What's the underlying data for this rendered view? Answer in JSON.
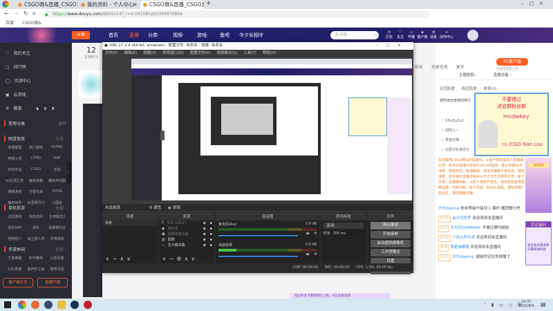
{
  "browser": {
    "tabs": [
      {
        "label": "CSGO微&直播_CSGO直播_"
      },
      {
        "label": "我的资料 - 个人中心 - 斗鱼"
      },
      {
        "label": "CSGO微&直播_CSGO直播_"
      }
    ],
    "new_tab": "+",
    "url_scheme": "https://",
    "url_host": "www.douyu.com",
    "url_path": "/6959154?_r=0.0415852023939768­94",
    "bookmarks": [
      "百度",
      "CSGO微&"
    ]
  },
  "douyu": {
    "nav": [
      "首页",
      "直播",
      "分类·",
      "视频·",
      "游戏·",
      "鱼吧",
      "今夕长相守"
    ],
    "search_placeholder": "无法搜",
    "header_icons": [
      "历史",
      "关注",
      "开播",
      "客户端",
      "消息",
      "创作中心"
    ],
    "stats": {
      "value": "12",
      "label": "主播积分"
    },
    "actions": [
      "粉丝",
      "充能任务",
      "更多"
    ],
    "pc_client": "PC客户端",
    "pc_client_sub": "主播用桌面上线",
    "follow": "关注"
  },
  "sidebar": {
    "items": [
      "我的关注",
      "排行榜",
      "页游中心",
      "云游戏",
      "赛事"
    ],
    "sections": [
      {
        "title": "常用分类",
        "more": "展开",
        "items": []
      },
      {
        "title": "网游竞技",
        "more": "全部 ›",
        "items": [
          "英雄联盟",
          "热门游戏",
          "DOTA2",
          "穿越火线",
          "CFHD",
          "DNF",
          "炉石传说",
          "CSGO",
          "逆战",
          "lol云顶之弈",
          "魔兽争霸",
          "魔兽怀旧服",
          "网络游戏",
          "守望先锋",
          "DOTA",
          "魔兽世界",
          "天涯明月刀",
          "三国杀"
        ]
      },
      {
        "title": "单机热游",
        "more": "全部 ›",
        "items": [
          "主机游戏",
          "永劫无间",
          "生死狙击2",
          "逃失ARX",
          "逃失",
          "逃离塔科夫",
          "怪物猎人",
          "海上猎人师",
          "环境游戏"
        ]
      },
      {
        "title": "手游休闲",
        "more": "全部 ›",
        "items": [
          "王者荣耀",
          "和平精英",
          "火影忍者",
          "LOL手游",
          "金铲铲之战",
          "黎明寻回"
        ]
      }
    ],
    "client_btn": "客户端打开",
    "live_btn": "直播开播"
  },
  "obs": {
    "title": "OBS 27.2.4 (64-bit, windows) - 配置文件: 未命名 - 场景: 未命名",
    "menu": [
      "文件(F)",
      "编辑(E)",
      "视图(V)",
      "停靠窗口(D)",
      "配置文件(P)",
      "场景集合(S)",
      "工具(T)",
      "帮助(H)"
    ],
    "no_source": "未选择源",
    "props": "属性",
    "filters": "滤镜",
    "scenes_header": "场景",
    "scenes": [
      "场景"
    ],
    "sources_header": "来源",
    "sources": [
      "文本 (GDI+)",
      "游戏源",
      "视频采集设备",
      "图像",
      "显示器采集"
    ],
    "mixer_header": "混音器",
    "mixer": [
      {
        "name": "麦克风/Aux",
        "db": "0.0 dB",
        "level": 0
      },
      {
        "name": "桌面音频",
        "db": "0.0 dB",
        "level": 0.18
      }
    ],
    "transitions_header": "转场特效",
    "transition": "淡出",
    "duration_label": "时长",
    "duration": "300 ms",
    "controls_header": "控件",
    "controls": [
      "停止推流",
      "开始录制",
      "启动虚拟摄像机",
      "工作室模式",
      "设置",
      "退出"
    ],
    "status": {
      "live": "LIVE: 00:00:00",
      "rec": "REC: 00:00:00",
      "cpu": "CPU: 1.3%, 60.00 fps"
    }
  },
  "right": {
    "rank_tabs": [
      "主播投稿 ›",
      "直播设备 ›"
    ],
    "sub_tabs": [
      "日活跃度",
      "周活跃度",
      "贵宾(0)"
    ],
    "rank_title": "按照亲密度榜前排行",
    "rank_users": [
      "XHuZuZu2",
      "初阵儿~",
      "朱家交嘲",
      "白昼对长夜恋分"
    ],
    "promo": [
      "不要错过",
      "进驻群粉丝群",
      "msdwkey",
      "cs /CGO Nan Lou"
    ],
    "system_msg": "欢迎来到CSGO微&的直播间。斗鱼严禁未成年人直播或打赏。依法对直播内容进行24小时巡查，禁止传播违法违规、低俗色情、吸烟酗酒、造谣诈骗等不良信息。理性消费，如主播在直播过程中以不正当方式诱导打赏、私下交易，请谨慎判断，以防人身财产损失。请勿轻信各类招聘征婚、代练代购、私下交易、购买礼包码、游戏币等广告信息，谨防网络诈骗。",
    "chat": [
      {
        "level": "",
        "user": "木头blazing",
        "text": "粉丝等级升级到 1 爆炸 撞团慢行吧"
      },
      {
        "level": "LV 16",
        "user": "会计司发罗",
        "text": "欢迎来到本直播间"
      },
      {
        "level": "LV 6",
        "user": "无与伦比666666:",
        "text": "不看比赛吗超前"
      },
      {
        "level": "LV 16",
        "user": "少女心的大叔",
        "text": "欢迎来到本直播间"
      },
      {
        "level": "LV 8",
        "user": "我是谁憨憨",
        "text": "欢迎来到本直播间"
      },
      {
        "level": "LV 15",
        "user": "木头blazing:",
        "text": "超前你记住你掉播了"
      }
    ],
    "ad_amount": "5000",
    "ad_title": "幸运福利",
    "ad_desc": "送出会员每逢每日最新福利榜",
    "notify": "钻石秋冬卡爆款限时上线，点击查看详情"
  },
  "taskbar": {
    "time": "19:37",
    "date": "2022/8/4"
  },
  "colors": {
    "accent": "#ff5d23",
    "douyu_header": "#221d6a",
    "sidebar": "#2a2b33",
    "obs_bg": "#2b2b2b"
  }
}
